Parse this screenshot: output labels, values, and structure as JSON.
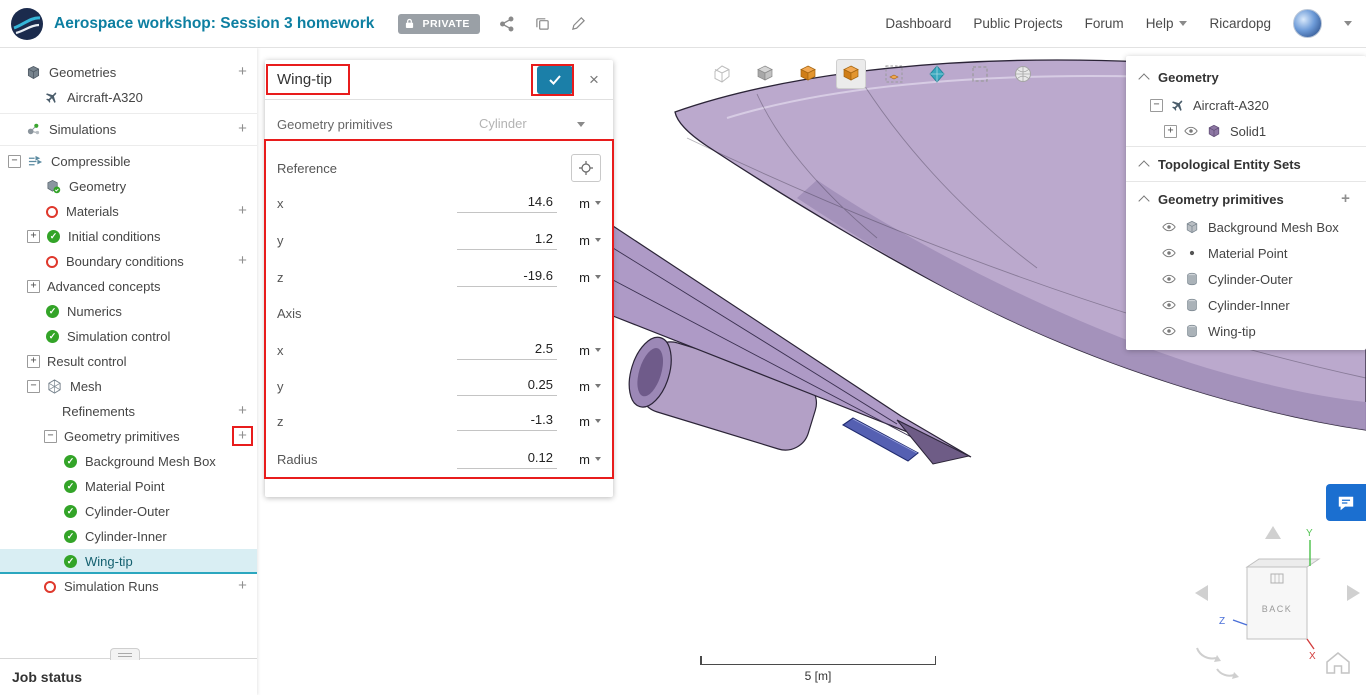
{
  "header": {
    "title": "Aerospace workshop: Session 3 homework",
    "private_badge": "PRIVATE",
    "action_icons": [
      "share-icon",
      "duplicate-icon",
      "rename-icon"
    ],
    "nav": {
      "dashboard": "Dashboard",
      "public_projects": "Public Projects",
      "forum": "Forum",
      "help": "Help",
      "username": "Ricardopg"
    }
  },
  "left_tree": {
    "items": [
      {
        "label": "Geometries"
      },
      {
        "label": "Aircraft-A320"
      },
      {
        "label": "Simulations"
      },
      {
        "label": "Compressible"
      },
      {
        "label": "Geometry"
      },
      {
        "label": "Materials"
      },
      {
        "label": "Initial conditions"
      },
      {
        "label": "Boundary conditions"
      },
      {
        "label": "Advanced concepts"
      },
      {
        "label": "Numerics"
      },
      {
        "label": "Simulation control"
      },
      {
        "label": "Result control"
      },
      {
        "label": "Mesh"
      },
      {
        "label": "Refinements"
      },
      {
        "label": "Geometry primitives"
      },
      {
        "label": "Background Mesh Box"
      },
      {
        "label": "Material Point"
      },
      {
        "label": "Cylinder-Outer"
      },
      {
        "label": "Cylinder-Inner"
      },
      {
        "label": "Wing-tip"
      },
      {
        "label": "Simulation Runs"
      }
    ],
    "job_status": "Job status"
  },
  "panel": {
    "title": "Wing-tip",
    "type_label": "Geometry primitives",
    "type_value": "Cylinder",
    "reference_label": "Reference",
    "axis_label": "Axis",
    "fields": {
      "ref_x": {
        "label": "x",
        "value": "14.6",
        "unit": "m"
      },
      "ref_y": {
        "label": "y",
        "value": "1.2",
        "unit": "m"
      },
      "ref_z": {
        "label": "z",
        "value": "-19.6",
        "unit": "m"
      },
      "axis_x": {
        "label": "x",
        "value": "2.5",
        "unit": "m"
      },
      "axis_y": {
        "label": "y",
        "value": "0.25",
        "unit": "m"
      },
      "axis_z": {
        "label": "z",
        "value": "-1.3",
        "unit": "m"
      },
      "radius": {
        "label": "Radius",
        "value": "0.12",
        "unit": "m"
      }
    }
  },
  "right_panel": {
    "geometry_header": "Geometry",
    "geometry_items": [
      {
        "label": "Aircraft-A320"
      },
      {
        "label": "Solid1"
      }
    ],
    "topo_header": "Topological Entity Sets",
    "primitives_header": "Geometry primitives",
    "primitives": [
      {
        "label": "Background Mesh Box"
      },
      {
        "label": "Material Point"
      },
      {
        "label": "Cylinder-Outer"
      },
      {
        "label": "Cylinder-Inner"
      },
      {
        "label": "Wing-tip"
      }
    ]
  },
  "viewport": {
    "toolbar_icons": [
      "wireframe-view-icon",
      "solid-view-icon",
      "geometry-view-icon",
      "geometry-selected-view-icon",
      "bounding-box-view-icon",
      "primitive-view-icon",
      "box-select-icon",
      "mesh-view-icon"
    ],
    "scale_label": "5 [m]",
    "cube_face_label": "BACK",
    "axis_labels": {
      "x": "X",
      "y": "Y",
      "z": "Z"
    }
  }
}
